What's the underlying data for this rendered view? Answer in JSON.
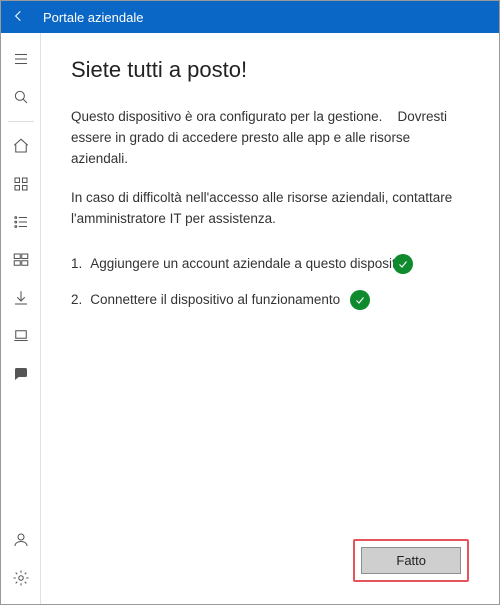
{
  "titlebar": {
    "title": "Portale aziendale"
  },
  "main": {
    "heading": "Siete tutti a posto!",
    "paragraph1a": "Questo dispositivo è ora configurato per la gestione.",
    "paragraph1b": "Dovresti essere in grado di accedere presto alle app e alle risorse aziendali.",
    "paragraph2": "In caso di difficoltà nell'accesso alle risorse aziendali, contattare l'amministratore IT per assistenza.",
    "steps": [
      {
        "num": "1.",
        "label": "Aggiungere un account aziendale a questo dispositivo"
      },
      {
        "num": "2.",
        "label": "Connettere il dispositivo al funzionamento"
      }
    ],
    "doneLabel": "Fatto"
  },
  "sidebarIcons": [
    "menu-icon",
    "search-icon",
    "divider",
    "home-icon",
    "apps-grid-icon",
    "list-icon",
    "tiles-icon",
    "download-icon",
    "laptop-icon",
    "chat-icon"
  ],
  "sidebarBottom": [
    "user-icon",
    "settings-icon"
  ],
  "colors": {
    "accent": "#0b67c6",
    "success": "#0f8a2f",
    "highlight": "#e5545a"
  }
}
